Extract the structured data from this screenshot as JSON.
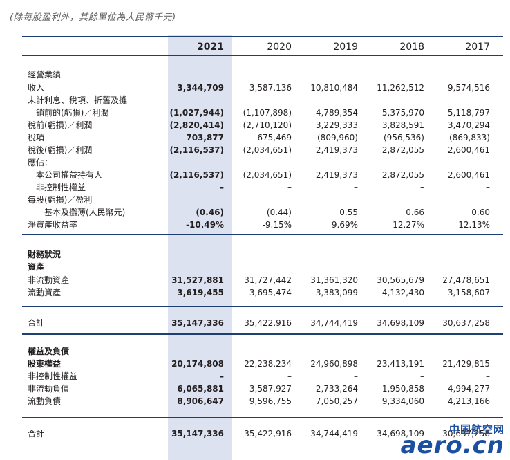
{
  "note": "(除每股盈利外，其餘單位為人民幣千元)",
  "years": [
    "2021",
    "2020",
    "2019",
    "2018",
    "2017"
  ],
  "rows": [
    {
      "label": "經營業績",
      "bold": false,
      "values": [
        "",
        "",
        "",
        "",
        ""
      ]
    },
    {
      "label": "收入",
      "bold": false,
      "values": [
        "3,344,709",
        "3,587,136",
        "10,810,484",
        "11,262,512",
        "9,574,516"
      ]
    },
    {
      "label": "未計利息、稅項、折舊及攤",
      "bold": false,
      "values": [
        "",
        "",
        "",
        "",
        ""
      ]
    },
    {
      "label": "　銷前的(虧損)／利潤",
      "bold": false,
      "values": [
        "(1,027,944)",
        "(1,107,898)",
        "4,789,354",
        "5,375,970",
        "5,118,797"
      ]
    },
    {
      "label": "稅前(虧損)／利潤",
      "bold": false,
      "values": [
        "(2,820,414)",
        "(2,710,120)",
        "3,229,333",
        "3,828,591",
        "3,470,294"
      ]
    },
    {
      "label": "稅項",
      "bold": false,
      "values": [
        "703,877",
        "675,469",
        "(809,960)",
        "(956,536)",
        "(869,833)"
      ]
    },
    {
      "label": "稅後(虧損)／利潤",
      "bold": false,
      "values": [
        "(2,116,537)",
        "(2,034,651)",
        "2,419,373",
        "2,872,055",
        "2,600,461"
      ]
    },
    {
      "label": "應佔：",
      "bold": false,
      "values": [
        "",
        "",
        "",
        "",
        ""
      ]
    },
    {
      "label": "　本公司權益持有人",
      "bold": false,
      "values": [
        "(2,116,537)",
        "(2,034,651)",
        "2,419,373",
        "2,872,055",
        "2,600,461"
      ]
    },
    {
      "label": "　非控制性權益",
      "bold": false,
      "values": [
        "–",
        "–",
        "–",
        "–",
        "–"
      ]
    },
    {
      "label": "每股(虧損)／盈利",
      "bold": false,
      "values": [
        "",
        "",
        "",
        "",
        ""
      ]
    },
    {
      "label": "　－基本及攤薄(人民幣元)",
      "bold": false,
      "values": [
        "(0.46)",
        "(0.44)",
        "0.55",
        "0.66",
        "0.60"
      ]
    },
    {
      "label": "淨資產收益率",
      "bold": false,
      "values": [
        "-10.49%",
        "-9.15%",
        "9.69%",
        "12.27%",
        "12.13%"
      ]
    },
    {
      "label": "財務狀況",
      "bold": true,
      "values": [
        "",
        "",
        "",
        "",
        ""
      ]
    },
    {
      "label": "資產",
      "bold": true,
      "values": [
        "",
        "",
        "",
        "",
        ""
      ]
    },
    {
      "label": "非流動資產",
      "bold": false,
      "values": [
        "31,527,881",
        "31,727,442",
        "31,361,320",
        "30,565,679",
        "27,478,651"
      ]
    },
    {
      "label": "流動資產",
      "bold": false,
      "values": [
        "3,619,455",
        "3,695,474",
        "3,383,099",
        "4,132,430",
        "3,158,607"
      ]
    },
    {
      "label": "合計",
      "bold": false,
      "values": [
        "35,147,336",
        "35,422,916",
        "34,744,419",
        "34,698,109",
        "30,637,258"
      ]
    },
    {
      "label": "權益及負債",
      "bold": true,
      "values": [
        "",
        "",
        "",
        "",
        ""
      ]
    },
    {
      "label": "股東權益",
      "bold": true,
      "values": [
        "20,174,808",
        "22,238,234",
        "24,960,898",
        "23,413,191",
        "21,429,815"
      ]
    },
    {
      "label": "非控制性權益",
      "bold": false,
      "values": [
        "–",
        "–",
        "–",
        "–",
        "–"
      ]
    },
    {
      "label": "非流動負債",
      "bold": false,
      "values": [
        "6,065,881",
        "3,587,927",
        "2,733,264",
        "1,950,858",
        "4,994,277"
      ]
    },
    {
      "label": "流動負債",
      "bold": false,
      "values": [
        "8,906,647",
        "9,596,755",
        "7,050,257",
        "9,334,060",
        "4,213,166"
      ]
    },
    {
      "label": "合計",
      "bold": false,
      "values": [
        "35,147,336",
        "35,422,916",
        "34,744,419",
        "34,698,109",
        "30,637,258"
      ]
    }
  ],
  "watermark": {
    "cn": "中国航空网",
    "en": "aero.cn"
  },
  "colors": {
    "rule": "#1f3f73",
    "highlight": "#dde2f0",
    "watermark": "#1b4fa0"
  }
}
